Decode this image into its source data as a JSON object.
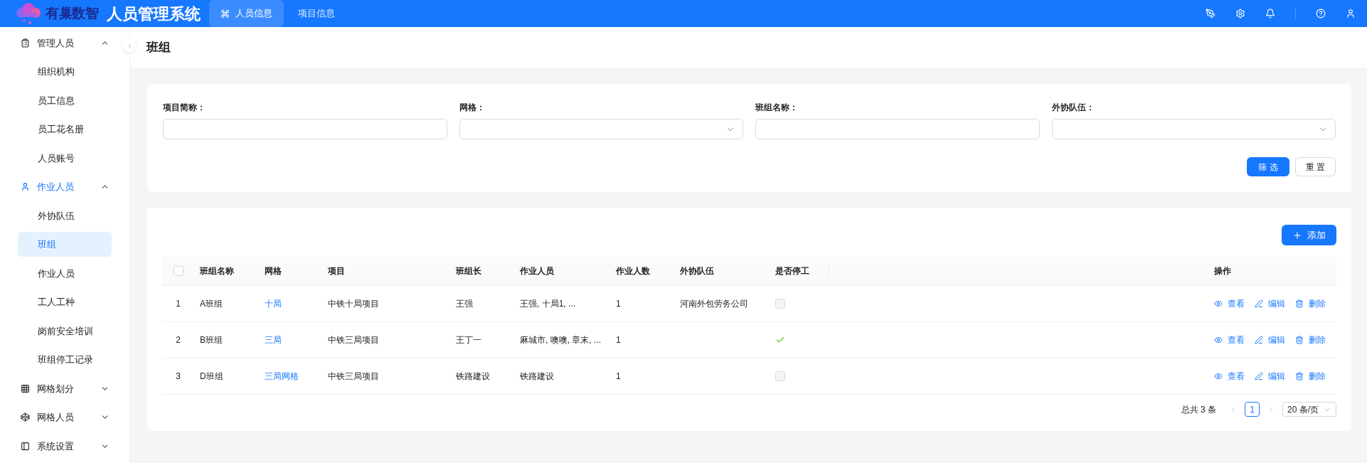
{
  "header": {
    "logo_text": "有巢数智",
    "app_title": "人员管理系统",
    "tabs": [
      {
        "label": "人员信息",
        "selected": true
      },
      {
        "label": "项目信息",
        "selected": false
      }
    ]
  },
  "sidebar": {
    "groups": [
      {
        "label": "管理人员",
        "kind": "form",
        "expanded": true,
        "children": [
          {
            "label": "组织机构",
            "selected": false
          },
          {
            "label": "员工信息",
            "selected": false
          },
          {
            "label": "员工花名册",
            "selected": false
          },
          {
            "label": "人员账号",
            "selected": false
          }
        ]
      },
      {
        "label": "作业人员",
        "kind": "user",
        "expanded": true,
        "children": [
          {
            "label": "外协队伍",
            "selected": false
          },
          {
            "label": "班组",
            "selected": true
          },
          {
            "label": "作业人员",
            "selected": false
          },
          {
            "label": "工人工种",
            "selected": false
          },
          {
            "label": "岗前安全培训",
            "selected": false
          },
          {
            "label": "班组停工记录",
            "selected": false
          }
        ]
      },
      {
        "label": "网格划分",
        "kind": "table",
        "expanded": false
      },
      {
        "label": "网格人员",
        "kind": "cube",
        "expanded": false
      },
      {
        "label": "系统设置",
        "kind": "panel",
        "expanded": false
      }
    ]
  },
  "page_title": "班组",
  "filters": [
    {
      "label": "项目简称：",
      "kind": "text"
    },
    {
      "label": "网格：",
      "kind": "select"
    },
    {
      "label": "班组名称：",
      "kind": "text"
    },
    {
      "label": "外协队伍：",
      "kind": "select"
    }
  ],
  "filter_buttons": {
    "submit": "筛 选",
    "reset": "重 置"
  },
  "add_button": "添加",
  "table": {
    "select_all": {
      "checked": false
    },
    "columns": [
      "班组名称",
      "网格",
      "项目",
      "班组长",
      "作业人员",
      "作业人数",
      "外协队伍",
      "是否停工",
      "操作"
    ],
    "rows": [
      {
        "index": "1",
        "name": "A班组",
        "grid": "十局",
        "project": "中铁十局项目",
        "leader": "王强",
        "workers": "王强, 十局1, ...",
        "count": "1",
        "team": "河南外包劳务公司",
        "stopped": false,
        "actions": [
          {
            "kind": "view",
            "label": "查看"
          },
          {
            "kind": "edit",
            "label": "编辑"
          },
          {
            "kind": "delete",
            "label": "删除"
          }
        ]
      },
      {
        "index": "2",
        "name": "B班组",
        "grid": "三局",
        "project": "中铁三局项目",
        "leader": "王丁一",
        "workers": "麻城市, 噢噢, 章末, ...",
        "count": "1",
        "stopped": true,
        "actions": [
          {
            "kind": "view",
            "label": "查看"
          },
          {
            "kind": "edit",
            "label": "编辑"
          },
          {
            "kind": "delete",
            "label": "删除"
          }
        ]
      },
      {
        "index": "3",
        "name": "D班组",
        "grid": "三局网格",
        "project": "中铁三局项目",
        "leader": "铁路建设",
        "workers": "铁路建设",
        "count": "1",
        "stopped": false,
        "actions": [
          {
            "kind": "view",
            "label": "查看"
          },
          {
            "kind": "edit",
            "label": "编辑"
          },
          {
            "kind": "delete",
            "label": "删除"
          }
        ]
      }
    ]
  },
  "pagination": {
    "total": "总共 3 条",
    "pages": [
      {
        "label": "1",
        "selected": true
      }
    ],
    "page_size": "20 条/页"
  }
}
